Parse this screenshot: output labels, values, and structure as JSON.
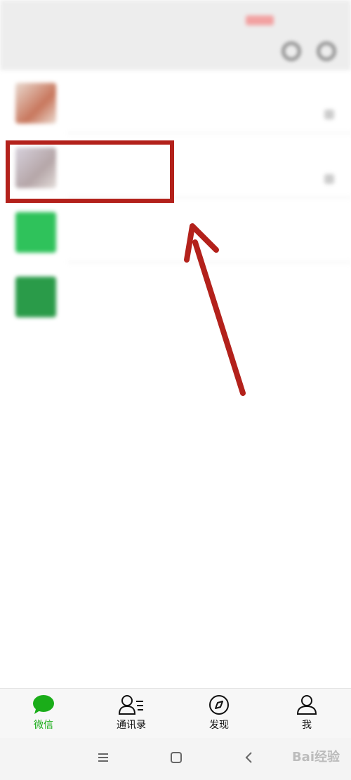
{
  "header": {
    "status_left": "",
    "status_right": "",
    "title": ""
  },
  "chats": [
    {
      "name": "",
      "preview": "",
      "time": ""
    },
    {
      "name": "",
      "preview": "",
      "time": ""
    },
    {
      "name": "",
      "preview": "",
      "time": ""
    },
    {
      "name": "",
      "preview": "",
      "time": ""
    }
  ],
  "tabs": [
    {
      "label": "微信",
      "icon": "chat-bubble-icon",
      "active": true
    },
    {
      "label": "通讯录",
      "icon": "contacts-icon",
      "active": false
    },
    {
      "label": "发现",
      "icon": "compass-icon",
      "active": false
    },
    {
      "label": "我",
      "icon": "person-icon",
      "active": false
    }
  ],
  "system_nav": {
    "buttons": [
      "menu-icon",
      "home-icon",
      "back-icon"
    ]
  },
  "watermark": "Bai经验",
  "colors": {
    "accent_green": "#1aad19",
    "highlight_red": "#b3211b",
    "tabbar_bg": "#f7f7f7"
  }
}
